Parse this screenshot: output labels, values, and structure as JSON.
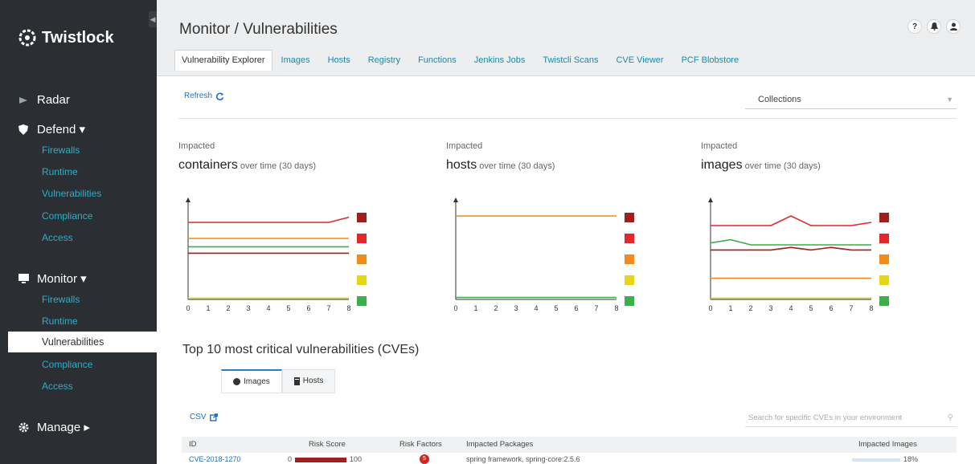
{
  "app": {
    "name": "Twistlock"
  },
  "sidebar": {
    "sections": [
      {
        "label": "Radar",
        "icon": "radar-icon",
        "items": []
      },
      {
        "label": "Defend ▾",
        "icon": "shield-icon",
        "items": [
          "Firewalls",
          "Runtime",
          "Vulnerabilities",
          "Compliance",
          "Access"
        ]
      },
      {
        "label": "Monitor ▾",
        "icon": "monitor-icon",
        "items": [
          "Firewalls",
          "Runtime",
          "Vulnerabilities",
          "Compliance",
          "Access"
        ],
        "active_item": "Vulnerabilities"
      },
      {
        "label": "Manage ▸",
        "icon": "gear-icon",
        "items": []
      }
    ]
  },
  "header": {
    "title": "Monitor / Vulnerabilities",
    "tabs": [
      {
        "label": "Vulnerability Explorer",
        "active": true
      },
      {
        "label": "Images"
      },
      {
        "label": "Hosts"
      },
      {
        "label": "Registry"
      },
      {
        "label": "Functions"
      },
      {
        "label": "Jenkins Jobs"
      },
      {
        "label": "Twistcli Scans"
      },
      {
        "label": "CVE Viewer"
      },
      {
        "label": "PCF Blobstore"
      }
    ],
    "icons": [
      "help-icon",
      "bell-icon",
      "user-icon"
    ],
    "help_glyph": "?"
  },
  "toolbar": {
    "refresh_label": "Refresh",
    "collections_placeholder": "Collections"
  },
  "severity_colors": {
    "critical": "#a41d1d",
    "high": "#e4272b",
    "medium": "#f08c1b",
    "low": "#e8d51a",
    "negligible": "#3cae4a"
  },
  "charts": [
    {
      "kicker": "Impacted",
      "metric": "containers",
      "suffix": " over time (30 days)"
    },
    {
      "kicker": "Impacted",
      "metric": "hosts",
      "suffix": " over time (30 days)"
    },
    {
      "kicker": "Impacted",
      "metric": "images",
      "suffix": " over time (30 days)"
    }
  ],
  "chart_data": [
    {
      "type": "line",
      "title": "containers over time (30 days)",
      "x": [
        0,
        1,
        2,
        3,
        4,
        5,
        6,
        7,
        8
      ],
      "series": [
        {
          "color": "#e4272b",
          "values": [
            12,
            12,
            12,
            12,
            12,
            12,
            12,
            12,
            12.8
          ]
        },
        {
          "color": "#f08c1b",
          "values": [
            9.5,
            9.5,
            9.5,
            9.5,
            9.5,
            9.5,
            9.5,
            9.5,
            9.5
          ]
        },
        {
          "color": "#3cae4a",
          "values": [
            8.2,
            8.2,
            8.2,
            8.2,
            8.2,
            8.2,
            8.2,
            8.2,
            8.2
          ]
        },
        {
          "color": "#a41d1d",
          "values": [
            7.2,
            7.2,
            7.2,
            7.2,
            7.2,
            7.2,
            7.2,
            7.2,
            7.2
          ]
        },
        {
          "color": "#e8d51a",
          "values": [
            0.2,
            0.2,
            0.2,
            0.2,
            0.2,
            0.2,
            0.2,
            0.2,
            0.2
          ]
        }
      ],
      "xlim": [
        0,
        8
      ],
      "ylim": [
        0,
        15
      ]
    },
    {
      "type": "line",
      "title": "hosts over time (30 days)",
      "x": [
        0,
        1,
        2,
        3,
        4,
        5,
        6,
        7,
        8
      ],
      "series": [
        {
          "color": "#f08c1b",
          "values": [
            13,
            13,
            13,
            13,
            13,
            13,
            13,
            13,
            13
          ]
        },
        {
          "color": "#3cae4a",
          "values": [
            0.3,
            0.3,
            0.3,
            0.3,
            0.3,
            0.3,
            0.3,
            0.3,
            0.3
          ]
        }
      ],
      "xlim": [
        0,
        8
      ],
      "ylim": [
        0,
        15
      ]
    },
    {
      "type": "line",
      "title": "images over time (30 days)",
      "x": [
        0,
        1,
        2,
        3,
        4,
        5,
        6,
        7,
        8
      ],
      "series": [
        {
          "color": "#e4272b",
          "values": [
            11.5,
            11.5,
            11.5,
            11.5,
            13,
            11.5,
            11.5,
            11.5,
            12
          ]
        },
        {
          "color": "#3cae4a",
          "values": [
            8.8,
            9.3,
            8.5,
            8.5,
            8.5,
            8.5,
            8.5,
            8.5,
            8.5
          ]
        },
        {
          "color": "#a41d1d",
          "values": [
            7.7,
            7.7,
            7.7,
            7.7,
            8.1,
            7.7,
            8.1,
            7.7,
            7.7
          ]
        },
        {
          "color": "#f08c1b",
          "values": [
            3.3,
            3.3,
            3.3,
            3.3,
            3.3,
            3.3,
            3.3,
            3.3,
            3.3
          ]
        },
        {
          "color": "#e8d51a",
          "values": [
            0.2,
            0.2,
            0.2,
            0.2,
            0.2,
            0.2,
            0.2,
            0.2,
            0.2
          ]
        }
      ],
      "xlim": [
        0,
        8
      ],
      "ylim": [
        0,
        15
      ]
    }
  ],
  "top10": {
    "title": "Top 10 most critical vulnerabilities (CVEs)",
    "tabs": [
      {
        "label": "Images",
        "icon": "image-icon",
        "active": true
      },
      {
        "label": "Hosts",
        "icon": "host-icon"
      }
    ],
    "csv_label": "CSV",
    "search_placeholder": "Search for specific CVEs in your environment",
    "columns": [
      "ID",
      "Risk Score",
      "Risk Factors",
      "Impacted Packages",
      "Impacted Images"
    ],
    "rows": [
      {
        "id": "CVE-2018-1270",
        "risk_min": "0",
        "risk_max": "100",
        "risk_factors": "5",
        "packages": "spring framework, spring-core:2.5.6",
        "impacted": "18%"
      }
    ]
  }
}
